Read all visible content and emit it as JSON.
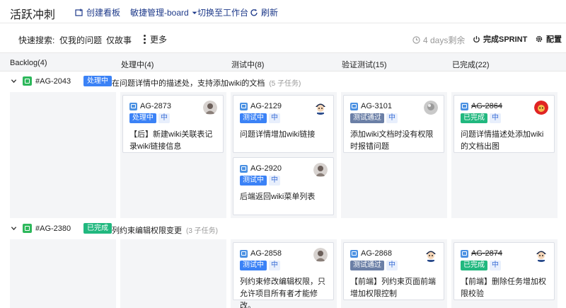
{
  "app": {
    "title": "活跃冲刺"
  },
  "header": {
    "create_board": "创建看板",
    "board_menu": "敏捷管理-board",
    "switch_workspace": "切换至工作台",
    "refresh": "刷新"
  },
  "quick": {
    "label": "快速搜索:",
    "mine": "仅我的问题",
    "story": "仅故事",
    "more": "更多",
    "remaining": "4 days剩余",
    "finish": "完成SPRINT",
    "config": "配置"
  },
  "columns": [
    "Backlog(4)",
    "处理中(4)",
    "测试中(8)",
    "验证测试(15)",
    "已完成(22)"
  ],
  "colors": {
    "processing": "#3b82f6",
    "testing": "#3b82f6",
    "verify": "#6b7fa6",
    "done": "#21b87f",
    "epic_blue": "#3b82f6",
    "green": "#2db85b"
  },
  "lanes": [
    {
      "key": "#AG-2043",
      "status": "处理中",
      "title": "在问题详情中的描述处，支持添加wiki的文档",
      "sub": "(5 子任务)"
    },
    {
      "key": "#AG-2380",
      "status": "已完成",
      "title": "列约束编辑权限变更",
      "sub": "(3 子任务)"
    }
  ],
  "cards": [
    {
      "key": "AG-2873",
      "status": "处理中",
      "priority": "中",
      "text": "【后】新建wiki关联表记录wiki链接信息"
    },
    {
      "key": "AG-2129",
      "status": "测试中",
      "priority": "中",
      "text": "问题详情增加wiki链接"
    },
    {
      "key": "AG-2920",
      "status": "测试中",
      "priority": "中",
      "text": "后端返回wiki菜单列表"
    },
    {
      "key": "AG-3101",
      "status": "测试通过",
      "priority": "中",
      "text": "添加wiki文档时没有权限时报错问题"
    },
    {
      "key": "AG-2864",
      "status": "已完成",
      "priority": "中",
      "text": "问题详情描述处添加wiki的文档出图"
    },
    {
      "key": "AG-2858",
      "status": "测试中",
      "priority": "中",
      "text": "列约束修改编辑权限，只允许项目所有者才能修改。"
    },
    {
      "key": "AG-2868",
      "status": "测试通过",
      "priority": "中",
      "text": "【前端】列约束页面前端增加权限控制"
    },
    {
      "key": "AG-2874",
      "status": "已完成",
      "priority": "中",
      "text": "【前端】删除任务增加权限校验"
    }
  ]
}
